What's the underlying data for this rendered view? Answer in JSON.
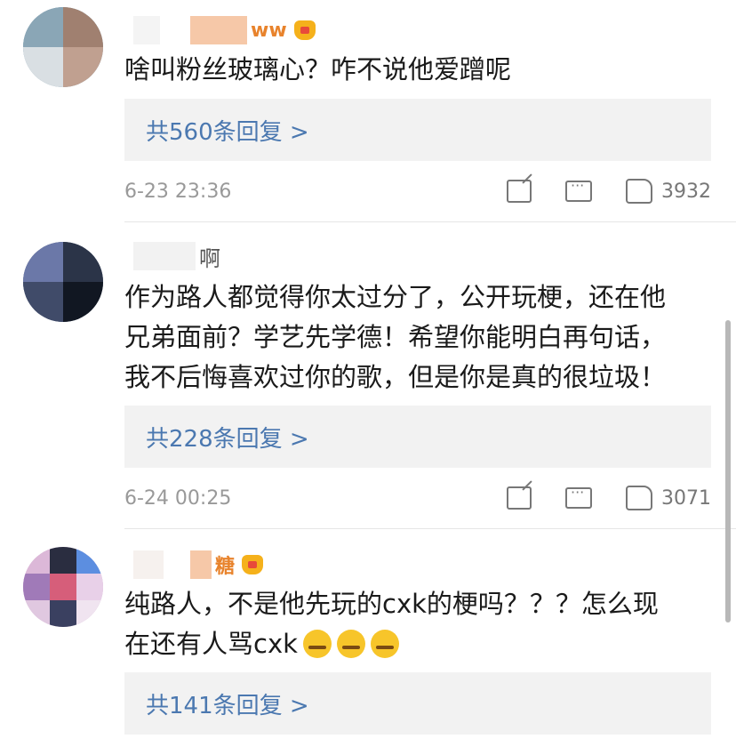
{
  "comments": [
    {
      "name": "ww",
      "text": "啥叫粉丝玻璃心？咋不说他爱蹭呢",
      "replies": "共560条回复 >",
      "time": "6-23 23:36",
      "likes": "3932"
    },
    {
      "name": "啊",
      "text_lines": [
        "作为路人都觉得你太过分了，公开玩梗，还在他",
        "兄弟面前？学艺先学德！希望你能明白再句话，",
        "我不后悔喜欢过你的歌，但是你是真的很垃圾！"
      ],
      "replies": "共228条回复 >",
      "time": "6-24 00:25",
      "likes": "3071"
    },
    {
      "name": "糖",
      "text_lines": [
        "纯路人，不是他先玩的cxk的梗吗？？？怎么现",
        "在还有人骂cxk"
      ],
      "replies": "共141条回复 >"
    }
  ],
  "icons": {
    "share": "share-icon",
    "comment": "comment-icon",
    "like": "like-icon",
    "vip": "crown-icon"
  },
  "colors": {
    "link": "#4b78b0",
    "vip_name": "#e8832c",
    "reply_bg": "#f2f2f2",
    "meta": "#999999"
  }
}
